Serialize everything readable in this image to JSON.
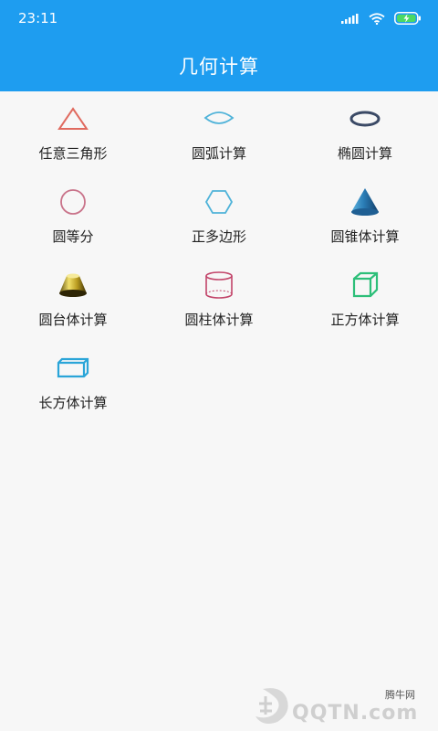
{
  "status": {
    "time": "23:11"
  },
  "header": {
    "title": "几何计算"
  },
  "tools": [
    {
      "label": "任意三角形",
      "icon": "triangle-icon"
    },
    {
      "label": "圆弧计算",
      "icon": "arc-icon"
    },
    {
      "label": "椭圆计算",
      "icon": "ellipse-icon"
    },
    {
      "label": "圆等分",
      "icon": "circle-icon"
    },
    {
      "label": "正多边形",
      "icon": "hexagon-icon"
    },
    {
      "label": "圆锥体计算",
      "icon": "cone-icon"
    },
    {
      "label": "圆台体计算",
      "icon": "frustum-icon"
    },
    {
      "label": "圆柱体计算",
      "icon": "cylinder-icon"
    },
    {
      "label": "正方体计算",
      "icon": "cube-icon"
    },
    {
      "label": "长方体计算",
      "icon": "cuboid-icon"
    }
  ],
  "watermark": {
    "site_name": "腾牛网",
    "brand": "QQTN.com"
  },
  "colors": {
    "primary": "#1e9df0",
    "triangle": "#e06a5f",
    "arc": "#4fb3d9",
    "ellipse": "#3b4a66",
    "circle": "#c9738a",
    "hexagon": "#4fb3d9",
    "cylinder": "#c2456a",
    "cube": "#2dbf79",
    "cuboid": "#2aa5d8"
  }
}
